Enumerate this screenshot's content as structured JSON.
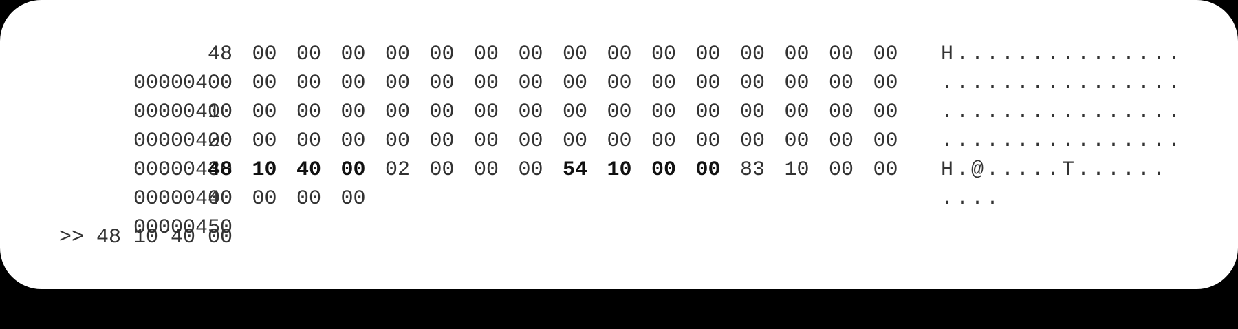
{
  "rows": [
    {
      "address": "00000400",
      "bytes": [
        {
          "v": "48",
          "b": false
        },
        {
          "v": "00",
          "b": false
        },
        {
          "v": "00",
          "b": false
        },
        {
          "v": "00",
          "b": false
        },
        {
          "v": "00",
          "b": false
        },
        {
          "v": "00",
          "b": false
        },
        {
          "v": "00",
          "b": false
        },
        {
          "v": "00",
          "b": false
        },
        {
          "v": "00",
          "b": false
        },
        {
          "v": "00",
          "b": false
        },
        {
          "v": "00",
          "b": false
        },
        {
          "v": "00",
          "b": false
        },
        {
          "v": "00",
          "b": false
        },
        {
          "v": "00",
          "b": false
        },
        {
          "v": "00",
          "b": false
        },
        {
          "v": "00",
          "b": false
        }
      ],
      "ascii": "H..............."
    },
    {
      "address": "00000410",
      "bytes": [
        {
          "v": "00",
          "b": false
        },
        {
          "v": "00",
          "b": false
        },
        {
          "v": "00",
          "b": false
        },
        {
          "v": "00",
          "b": false
        },
        {
          "v": "00",
          "b": false
        },
        {
          "v": "00",
          "b": false
        },
        {
          "v": "00",
          "b": false
        },
        {
          "v": "00",
          "b": false
        },
        {
          "v": "00",
          "b": false
        },
        {
          "v": "00",
          "b": false
        },
        {
          "v": "00",
          "b": false
        },
        {
          "v": "00",
          "b": false
        },
        {
          "v": "00",
          "b": false
        },
        {
          "v": "00",
          "b": false
        },
        {
          "v": "00",
          "b": false
        },
        {
          "v": "00",
          "b": false
        }
      ],
      "ascii": "................"
    },
    {
      "address": "00000420",
      "bytes": [
        {
          "v": "00",
          "b": false
        },
        {
          "v": "00",
          "b": false
        },
        {
          "v": "00",
          "b": false
        },
        {
          "v": "00",
          "b": false
        },
        {
          "v": "00",
          "b": false
        },
        {
          "v": "00",
          "b": false
        },
        {
          "v": "00",
          "b": false
        },
        {
          "v": "00",
          "b": false
        },
        {
          "v": "00",
          "b": false
        },
        {
          "v": "00",
          "b": false
        },
        {
          "v": "00",
          "b": false
        },
        {
          "v": "00",
          "b": false
        },
        {
          "v": "00",
          "b": false
        },
        {
          "v": "00",
          "b": false
        },
        {
          "v": "00",
          "b": false
        },
        {
          "v": "00",
          "b": false
        }
      ],
      "ascii": "................"
    },
    {
      "address": "00000430",
      "bytes": [
        {
          "v": "00",
          "b": false
        },
        {
          "v": "00",
          "b": false
        },
        {
          "v": "00",
          "b": false
        },
        {
          "v": "00",
          "b": false
        },
        {
          "v": "00",
          "b": false
        },
        {
          "v": "00",
          "b": false
        },
        {
          "v": "00",
          "b": false
        },
        {
          "v": "00",
          "b": false
        },
        {
          "v": "00",
          "b": false
        },
        {
          "v": "00",
          "b": false
        },
        {
          "v": "00",
          "b": false
        },
        {
          "v": "00",
          "b": false
        },
        {
          "v": "00",
          "b": false
        },
        {
          "v": "00",
          "b": false
        },
        {
          "v": "00",
          "b": false
        },
        {
          "v": "00",
          "b": false
        }
      ],
      "ascii": "................"
    },
    {
      "address": "00000440",
      "bytes": [
        {
          "v": "48",
          "b": true
        },
        {
          "v": "10",
          "b": true
        },
        {
          "v": "40",
          "b": true
        },
        {
          "v": "00",
          "b": true
        },
        {
          "v": "02",
          "b": false
        },
        {
          "v": "00",
          "b": false
        },
        {
          "v": "00",
          "b": false
        },
        {
          "v": "00",
          "b": false
        },
        {
          "v": "54",
          "b": true
        },
        {
          "v": "10",
          "b": true
        },
        {
          "v": "00",
          "b": true
        },
        {
          "v": "00",
          "b": true
        },
        {
          "v": "83",
          "b": false
        },
        {
          "v": "10",
          "b": false
        },
        {
          "v": "00",
          "b": false
        },
        {
          "v": "00",
          "b": false
        }
      ],
      "ascii": "H.@.....T......"
    },
    {
      "address": "00000450",
      "bytes": [
        {
          "v": "00",
          "b": false
        },
        {
          "v": "00",
          "b": false
        },
        {
          "v": "00",
          "b": false
        },
        {
          "v": "00",
          "b": false
        }
      ],
      "ascii": "...."
    }
  ],
  "command_line": ">> 48 10 40 00",
  "colors": {
    "background": "#ffffff",
    "text": "#333333",
    "bold_text": "#111111",
    "outer": "#000000"
  }
}
